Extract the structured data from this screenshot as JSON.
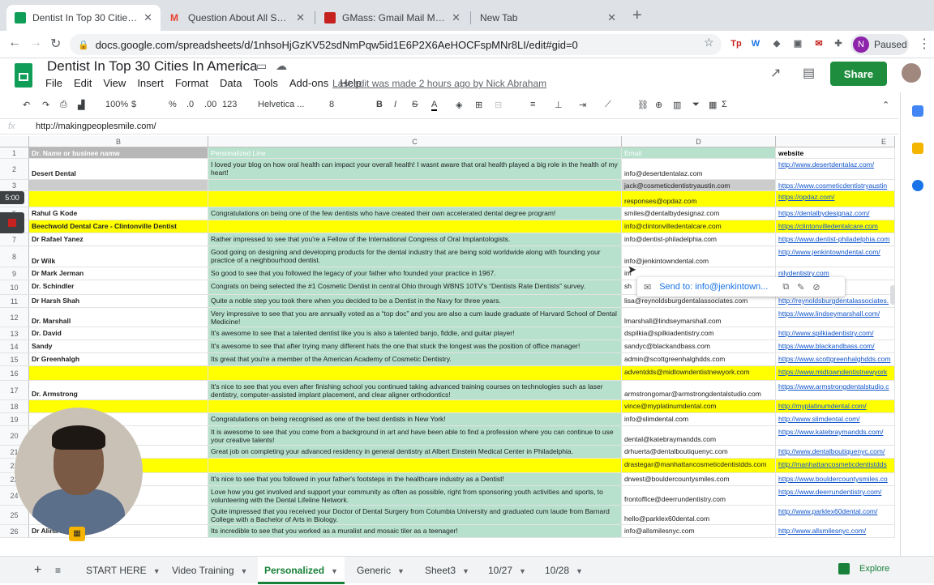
{
  "browser": {
    "tabs": [
      {
        "title": "Dentist In Top 30 Cities In Ameri",
        "color": "#0f9d58",
        "active": true
      },
      {
        "title": "Question About All Smiles Dent",
        "color": "#ea4335",
        "active": false
      },
      {
        "title": "GMass: Gmail Mail Merge | Ser",
        "color": "#c5221f",
        "active": false
      },
      {
        "title": "New Tab",
        "color": "",
        "active": false
      }
    ],
    "url": "docs.google.com/spreadsheets/d/1nhsoHjGzKV52sdNmPqw5id1E6P2X6AeHOCFspMNr8LI/edit#gid=0",
    "profile_initial": "N",
    "profile_status": "Paused"
  },
  "doc": {
    "title": "Dentist In Top 30 Cities In America",
    "menu": [
      "File",
      "Edit",
      "View",
      "Insert",
      "Format",
      "Data",
      "Tools",
      "Add-ons",
      "Help"
    ],
    "last_edit": "Last edit was made 2 hours ago by Nick Abraham",
    "share_label": "Share"
  },
  "toolbar": {
    "zoom": "100%",
    "currency": "$",
    "percent": "%",
    "dec_less": ".0",
    "dec_more": ".00",
    "format": "123",
    "font": "Helvetica ...",
    "font_size": "8"
  },
  "formula_bar": {
    "fx": "fx",
    "value": "http://makingpeoplesmile.com/"
  },
  "columns": [
    {
      "id": "B"
    },
    {
      "id": "C"
    },
    {
      "id": "D"
    },
    {
      "id": "E"
    }
  ],
  "rows": [
    {
      "n": "1",
      "h": 14,
      "style": "hdr",
      "b": "Dr. Name or businee namw",
      "c": "Personalized Line",
      "d": "Email",
      "e": "website"
    },
    {
      "n": "2",
      "h": 26,
      "style": "",
      "b": "Desert Dental",
      "c": "I loved your blog on how oral health can impact your overall health! I wasnt aware that oral health played a big role in the health of my heart!",
      "d": "info@desertdentalaz.com",
      "e": "http://www.desertdentalaz.com/"
    },
    {
      "n": "3",
      "h": 14,
      "style": "gray",
      "b": "",
      "c": "",
      "d": "jack@cosmeticdentistryaustin.com",
      "e": "https://www.cosmeticdentistryaustin"
    },
    {
      "n": "4",
      "h": 20,
      "style": "yel",
      "b": "",
      "c": "",
      "d": "responses@opdaz.com",
      "e": "https://opdaz.com/"
    },
    {
      "n": "5",
      "h": 16,
      "style": "",
      "b": "Rahul G Kode",
      "c": "Congratulations on being one of the few dentists who have created their own accelerated dental degree program!",
      "d": "smiles@dentalbydesignaz.com",
      "e": "https://dentalbydesignaz.com/"
    },
    {
      "n": "6",
      "h": 16,
      "style": "yel",
      "b": "Beechwold Dental Care - Clintonville Dentist",
      "c": "",
      "d": "info@clintonvilledentalcare.com",
      "e": "https://clintonvilledentalcare.com"
    },
    {
      "n": "7",
      "h": 16,
      "style": "",
      "b": "Dr Rafael Yanez",
      "c": "Rather impressed to see that you're a Fellow of the International Congress of Oral Implantologists.",
      "d": "info@dentist-philadelphia.com",
      "e": "https://www.dentist-philadelphia.com"
    },
    {
      "n": "8",
      "h": 26,
      "style": "",
      "b": "Dr Wilk",
      "c": "Good going on designing and developing products for the dental industry that are being sold worldwide along with founding your practice of a neighbourhood dentist.",
      "d": "info@jenkintowndental.com",
      "e": "http://www.jenkintowndental.com/"
    },
    {
      "n": "9",
      "h": 16,
      "style": "",
      "b": "Dr Mark Jerman",
      "c": "So good to see that you followed the legacy of your father who founded your practice in 1967.",
      "d": "inf",
      "e": "nilydentistry.com"
    },
    {
      "n": "10",
      "h": 18,
      "style": "",
      "b": "Dr. Schindler",
      "c": "Congrats on being selected the #1 Cosmetic Dentist in central Ohio through WBNS 10TV's “Dentists Rate Dentists” survey.",
      "d": "sh",
      "e": "dentistry.com/"
    },
    {
      "n": "11",
      "h": 16,
      "style": "",
      "b": "Dr Harsh Shah",
      "c": "Quite a noble step you took there when you decided to be a Dentist in the Navy for three years.",
      "d": "lisa@reynoldsburgdentalassociates.com",
      "e": "http://reynoldsburgdentalassociates."
    },
    {
      "n": "12",
      "h": 24,
      "style": "",
      "b": "Dr. Marshall",
      "c": "Very impressive to see that you are annually voted as a “top doc” and you are also a cum laude graduate of Harvard School of Dental Medicine!",
      "d": "lmarshall@lindseymarshall.com",
      "e": "https://www.lindseymarshall.com/"
    },
    {
      "n": "13",
      "h": 16,
      "style": "",
      "b": "Dr. David",
      "c": "It's awesome to see that a talented dentist like you is also a talented banjo, fiddle, and guitar player!",
      "d": "dspilkia@spilkiadentistry.com",
      "e": "http://www.spilkiadentistry.com/"
    },
    {
      "n": "14",
      "h": 16,
      "style": "",
      "b": "Sandy",
      "c": "It's awesome to see that after trying many different hats the one that stuck the longest was the position of office manager!",
      "d": "sandyc@blackandbass.com",
      "e": "https://www.blackandbass.com/"
    },
    {
      "n": "15",
      "h": 16,
      "style": "",
      "b": "Dr Greenhalgh",
      "c": "Its great that you're a member of the American Academy of Cosmetic Dentistry.",
      "d": "admin@scottgreenhalghdds.com",
      "e": "https://www.scottgreenhalghdds.com"
    },
    {
      "n": "16",
      "h": 18,
      "style": "yel",
      "b": "",
      "c": "",
      "d": "adventdds@midtowndentistnewyork.com",
      "e": "https://www.midtowndentistnewyork"
    },
    {
      "n": "17",
      "h": 24,
      "style": "",
      "b": "Dr. Armstrong",
      "c": "It's nice to see that you even after finishing school you continued taking advanced training courses on technologies such as laser dentistry, computer-assisted implant placement, and clear aligner orthodontics!",
      "d": "armstrongomar@armstrongdentalstudio.com",
      "e": "https://www.armstrongdentalstudio.c"
    },
    {
      "n": "18",
      "h": 16,
      "style": "yel",
      "b": "",
      "c": "",
      "d": "vince@myplatinumdental.com",
      "e": "http://myplatinumdental.com/"
    },
    {
      "n": "19",
      "h": 16,
      "style": "",
      "b": "",
      "c": "Congratulations on being recognised as one of the best dentists in New York!",
      "d": "info@slimdental.com",
      "e": "http://www.slimdental.com/"
    },
    {
      "n": "20",
      "h": 24,
      "style": "",
      "b": "",
      "c": "It is awesome to see that you come from a background in art and have been able to find a profession where you can continue to use your creative talents!",
      "d": "dental@katebraymandds.com",
      "e": "https://www.katebraymandds.com/"
    },
    {
      "n": "21",
      "h": 16,
      "style": "",
      "b": "",
      "c": "Great job on completing your advanced residency in general dentistry at Albert Einstein Medical Center in Philadelphia.",
      "d": "drhuerta@dentalboutiquenyc.com",
      "e": "http://www.dentalboutiquenyc.com/"
    },
    {
      "n": "22",
      "h": 18,
      "style": "yel",
      "b": "",
      "c": "",
      "d": "drastegar@manhattancosmeticdentistdds.com",
      "e": "http://manhattancosmeticdentistdds"
    },
    {
      "n": "23",
      "h": 16,
      "style": "",
      "b": "",
      "c": "It's nice to see that you followed in your father's footsteps in the healthcare industry as a Dentist!",
      "d": "drwest@bouldercountysmiles.com",
      "e": "https://www.bouldercountysmiles.co"
    },
    {
      "n": "24",
      "h": 24,
      "style": "",
      "b": "",
      "c": "Love how you get involved and support your community as often as possible, right from sponsoring youth activities and sports, to volunteering with the Dental Lifeline Network.",
      "d": "frontoffice@deerrundentistry.com",
      "e": "https://www.deerrundentistry.com/"
    },
    {
      "n": "25",
      "h": 24,
      "style": "",
      "b": "",
      "c": "Quite impressed that you received your Doctor of Dental Surgery from Columbia University and graduated cum laude from Barnard College with a Bachelor of Arts in Biology.",
      "d": "hello@parklex60dental.com",
      "e": "http://www.parklex60dental.com/"
    },
    {
      "n": "26",
      "h": 16,
      "style": "",
      "b": "Dr Alina La",
      "c": "Its incredible to see that you worked as a muralist and mosaic tiler as a teenager!",
      "d": "info@allsmilesnyc.com",
      "e": "http://www.allsmilesnyc.com/"
    }
  ],
  "tooltip": {
    "send_label": "Send to: info@jenkintown..."
  },
  "recorder": {
    "time": "5:00"
  },
  "sheet_tabs": [
    "START HERE",
    "Video Training",
    "Personalized",
    "Generic",
    "Sheet3",
    "10/27",
    "10/28"
  ],
  "active_sheet": "Personalized",
  "explore_label": "Explore"
}
